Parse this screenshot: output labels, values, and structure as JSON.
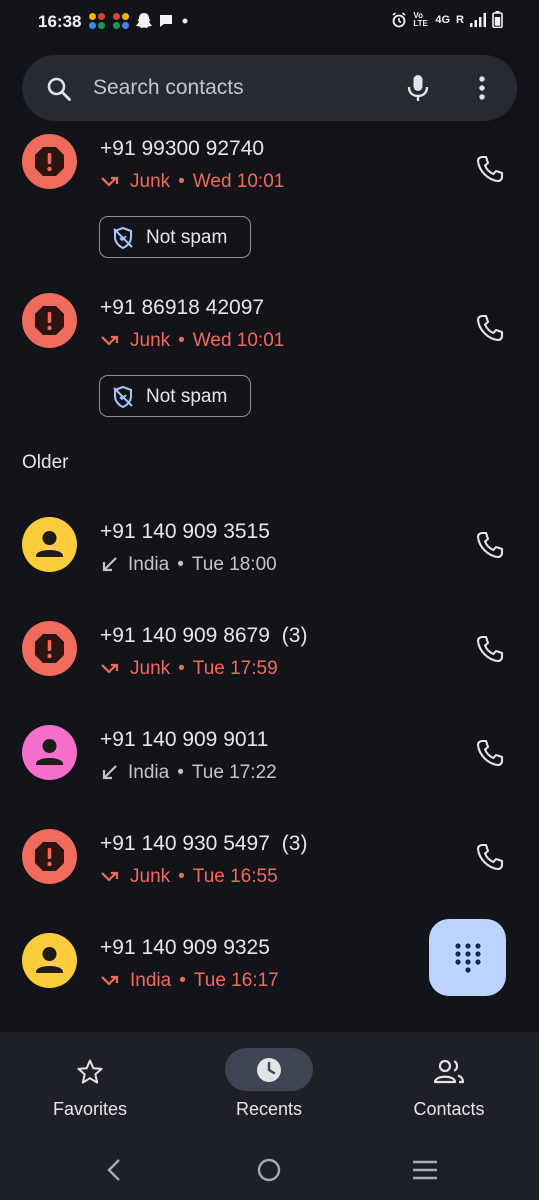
{
  "status_bar": {
    "time": "16:38",
    "network": "4G",
    "roaming": "R",
    "volte": "Vo LTE",
    "icons_left": [
      "app-grid-icon",
      "app-grid-icon",
      "snapchat-icon",
      "chat-bubble-icon",
      "dot-icon"
    ],
    "icons_right": [
      "alarm-icon",
      "volte-icon",
      "signal-icon",
      "battery-icon"
    ]
  },
  "search": {
    "placeholder": "Search contacts"
  },
  "calls": [
    {
      "number": "+91 99300 92740",
      "type": "junk",
      "label": "Junk",
      "time": "Wed 10:01",
      "not_spam": "Not spam"
    },
    {
      "number": "+91 86918 42097",
      "type": "junk",
      "label": "Junk",
      "time": "Wed 10:01",
      "not_spam": "Not spam"
    }
  ],
  "older_header": "Older",
  "older_calls": [
    {
      "number": "+91 140 909 3515",
      "count": "",
      "label": "India",
      "time": "Tue 18:00",
      "type": "incoming",
      "avatar_color": "#fbcd3c"
    },
    {
      "number": "+91 140 909 8679",
      "count": "(3)",
      "label": "Junk",
      "time": "Tue 17:59",
      "type": "junk",
      "avatar_color": "#ee6b5d"
    },
    {
      "number": "+91 140 909 9011",
      "count": "",
      "label": "India",
      "time": "Tue 17:22",
      "type": "incoming",
      "avatar_color": "#f56fcb"
    },
    {
      "number": "+91 140 930 5497",
      "count": "(3)",
      "label": "Junk",
      "time": "Tue 16:55",
      "type": "junk",
      "avatar_color": "#ee6b5d"
    },
    {
      "number": "+91 140 909 9325",
      "count": "",
      "label": "India",
      "time": "Tue 16:17",
      "type": "missed",
      "avatar_color": "#fbcd3c"
    }
  ],
  "separator": "•",
  "bottom_nav": {
    "favorites": "Favorites",
    "recents": "Recents",
    "contacts": "Contacts",
    "active": "recents"
  },
  "colors": {
    "background": "#12141a",
    "junk_red": "#ee6b5d",
    "fab": "#bcd2ff",
    "active_pill": "#3f4452"
  }
}
